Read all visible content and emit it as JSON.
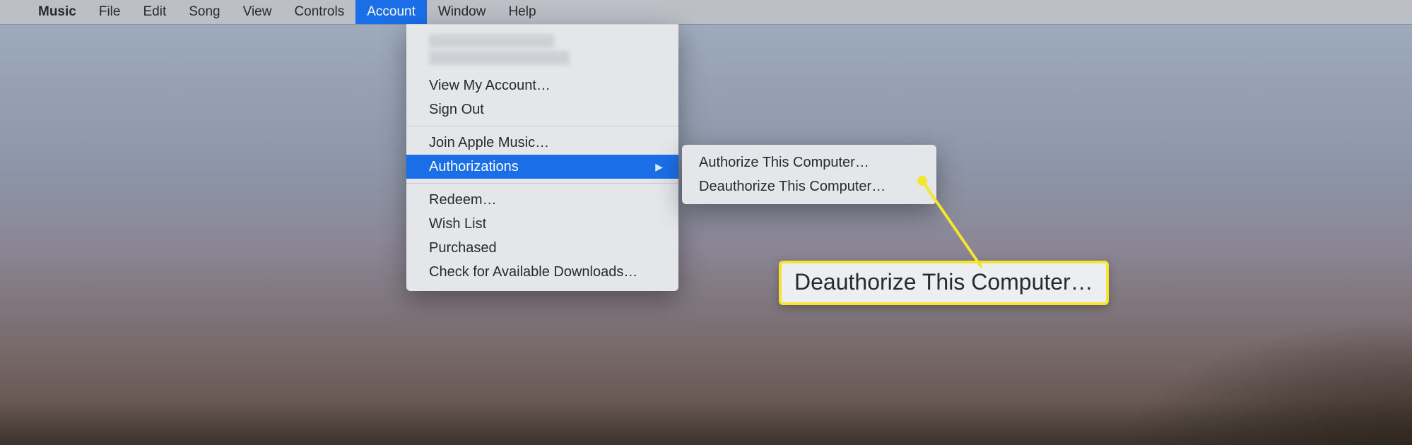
{
  "menubar": {
    "apple_icon": "apple-logo",
    "appname": "Music",
    "items": [
      "File",
      "Edit",
      "Song",
      "View",
      "Controls",
      "Account",
      "Window",
      "Help"
    ],
    "selected": "Account"
  },
  "account_menu": {
    "view_my_account": "View My Account…",
    "sign_out": "Sign Out",
    "join_apple_music": "Join Apple Music…",
    "authorizations": "Authorizations",
    "redeem": "Redeem…",
    "wish_list": "Wish List",
    "purchased": "Purchased",
    "check_downloads": "Check for Available Downloads…"
  },
  "authorizations_submenu": {
    "authorize": "Authorize This Computer…",
    "deauthorize": "Deauthorize This Computer…"
  },
  "callout": {
    "text": "Deauthorize This Computer…"
  }
}
